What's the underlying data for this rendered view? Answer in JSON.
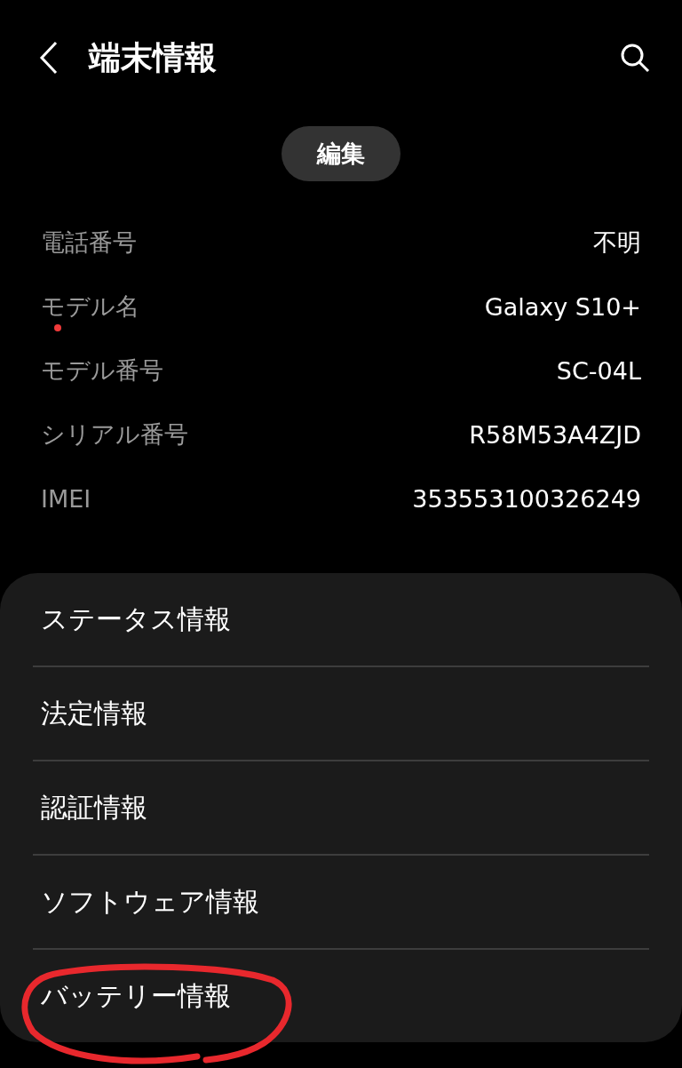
{
  "header": {
    "title": "端末情報"
  },
  "edit_button": {
    "label": "編集"
  },
  "info_rows": [
    {
      "label": "電話番号",
      "value": "不明",
      "dot": false
    },
    {
      "label": "モデル名",
      "value": "Galaxy S10+",
      "dot": true
    },
    {
      "label": "モデル番号",
      "value": "SC-04L",
      "dot": false
    },
    {
      "label": "シリアル番号",
      "value": "R58M53A4ZJD",
      "dot": false
    },
    {
      "label": "IMEI",
      "value": "353553100326249",
      "dot": false
    }
  ],
  "menu_items": [
    {
      "label": "ステータス情報",
      "circled": false
    },
    {
      "label": "法定情報",
      "circled": false
    },
    {
      "label": "認証情報",
      "circled": false
    },
    {
      "label": "ソフトウェア情報",
      "circled": false
    },
    {
      "label": "バッテリー情報",
      "circled": true
    }
  ]
}
